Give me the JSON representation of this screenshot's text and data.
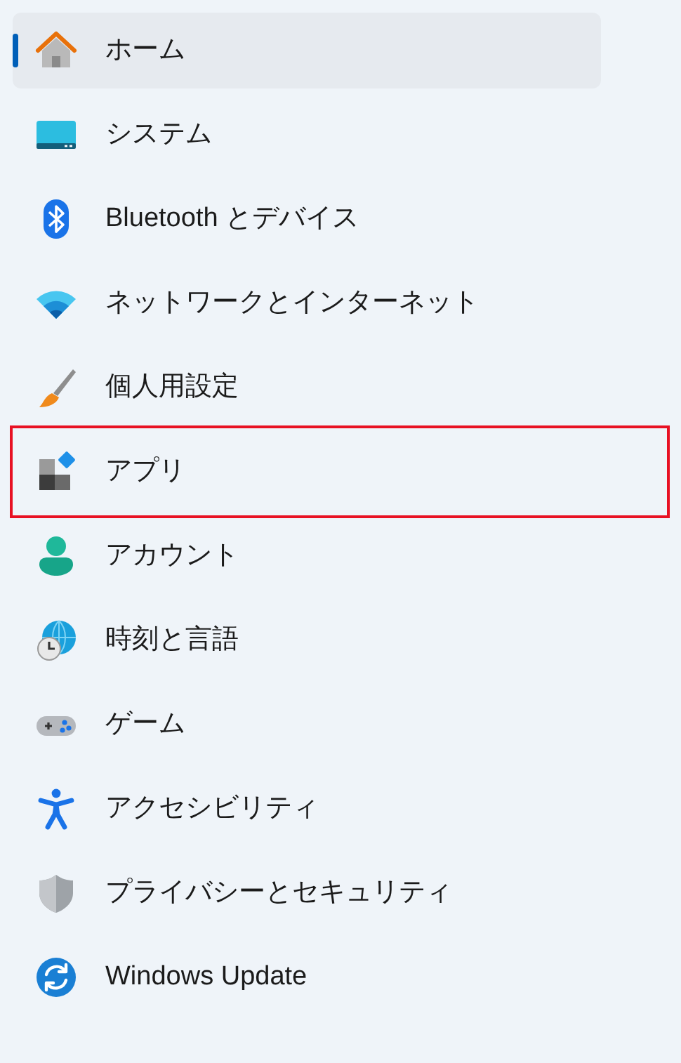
{
  "nav_items": [
    {
      "label": "ホーム",
      "selected": true,
      "highlighted": false
    },
    {
      "label": "システム",
      "selected": false,
      "highlighted": false
    },
    {
      "label": "Bluetooth とデバイス",
      "selected": false,
      "highlighted": false
    },
    {
      "label": "ネットワークとインターネット",
      "selected": false,
      "highlighted": false
    },
    {
      "label": "個人用設定",
      "selected": false,
      "highlighted": false
    },
    {
      "label": "アプリ",
      "selected": false,
      "highlighted": true
    },
    {
      "label": "アカウント",
      "selected": false,
      "highlighted": false
    },
    {
      "label": "時刻と言語",
      "selected": false,
      "highlighted": false
    },
    {
      "label": "ゲーム",
      "selected": false,
      "highlighted": false
    },
    {
      "label": "アクセシビリティ",
      "selected": false,
      "highlighted": false
    },
    {
      "label": "プライバシーとセキュリティ",
      "selected": false,
      "highlighted": false
    },
    {
      "label": "Windows Update",
      "selected": false,
      "highlighted": false
    }
  ]
}
